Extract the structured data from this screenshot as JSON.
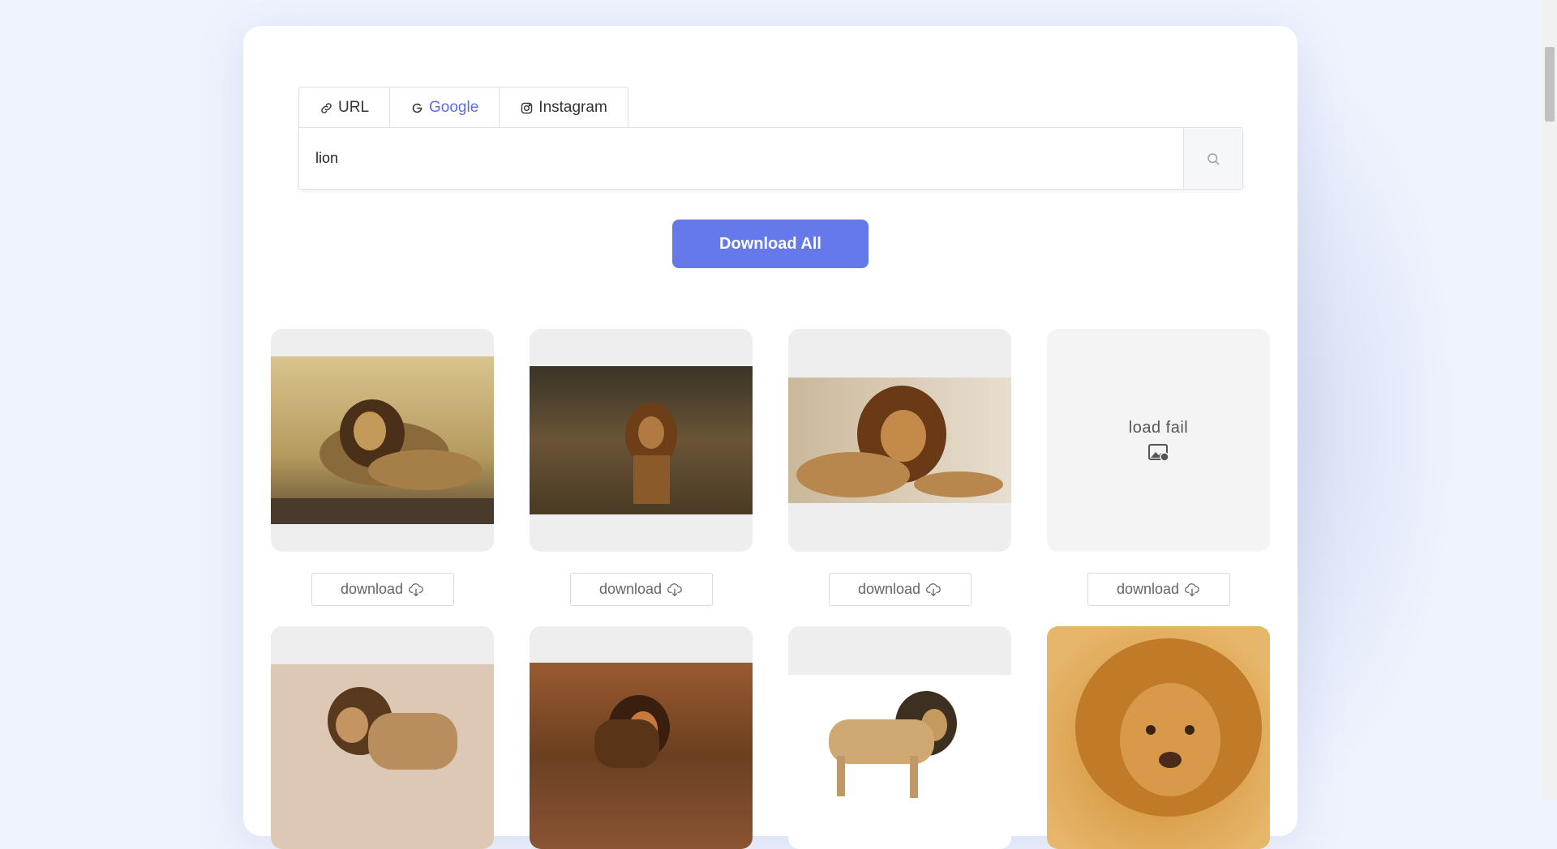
{
  "tabs": [
    {
      "label": "URL",
      "icon": "link-icon",
      "active": false
    },
    {
      "label": "Google",
      "icon": "google-icon",
      "active": true
    },
    {
      "label": "Instagram",
      "icon": "instagram-icon",
      "active": false
    }
  ],
  "search": {
    "value": "lion",
    "button_icon": "search-icon"
  },
  "actions": {
    "download_all_label": "Download All"
  },
  "images": [
    {
      "status": "loaded",
      "download_label": "download"
    },
    {
      "status": "loaded",
      "download_label": "download"
    },
    {
      "status": "loaded",
      "download_label": "download"
    },
    {
      "status": "failed",
      "fail_text": "load fail",
      "download_label": "download"
    },
    {
      "status": "loaded"
    },
    {
      "status": "loaded"
    },
    {
      "status": "loaded"
    },
    {
      "status": "loaded"
    }
  ],
  "colors": {
    "accent": "#6579ea",
    "active_tab": "#5b6ee1",
    "background": "#eef3fd"
  }
}
